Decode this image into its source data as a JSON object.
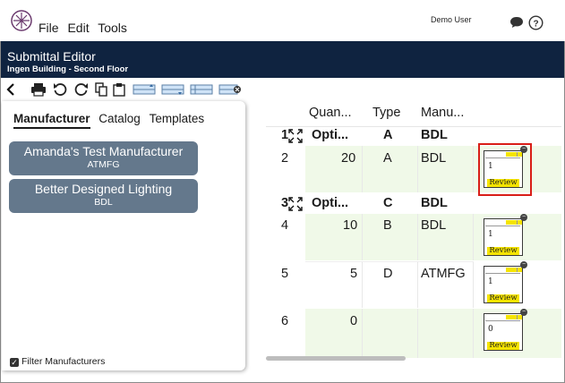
{
  "menu": {
    "file": "File",
    "edit": "Edit",
    "tools": "Tools"
  },
  "user": "Demo User",
  "header": {
    "title": "Submittal Editor",
    "subtitle": "Ingen Building - Second Floor"
  },
  "panel": {
    "tabs": [
      {
        "label": "Manufacturer",
        "active": true
      },
      {
        "label": "Catalog",
        "active": false
      },
      {
        "label": "Templates",
        "active": false
      }
    ],
    "manufacturers": [
      {
        "name": "Amanda's Test Manufacturer",
        "code": "ATMFG"
      },
      {
        "name": "Better Designed Lighting",
        "code": "BDL"
      }
    ],
    "filter_label": "Filter Manufacturers",
    "filter_checked": true
  },
  "grid": {
    "columns": {
      "quantity": "Quan...",
      "type": "Type",
      "manufacturer": "Manu..."
    },
    "rows": [
      {
        "num": "1",
        "group": true,
        "option": "Opti...",
        "type": "A",
        "mfr": "BDL"
      },
      {
        "num": "2",
        "qty": "20",
        "type": "A",
        "mfr": "BDL",
        "thumb_num": "1",
        "thumb_label": "Review"
      },
      {
        "num": "3",
        "group": true,
        "option": "Opti...",
        "type": "C",
        "mfr": "BDL"
      },
      {
        "num": "4",
        "qty": "10",
        "type": "B",
        "mfr": "BDL",
        "thumb_num": "1",
        "thumb_label": "Review"
      },
      {
        "num": "5",
        "qty": "5",
        "type": "D",
        "mfr": "ATMFG",
        "thumb_num": "1",
        "thumb_label": "Review"
      },
      {
        "num": "6",
        "qty": "0",
        "type": "",
        "mfr": "",
        "thumb_num": "0",
        "thumb_label": "Review"
      }
    ]
  },
  "colors": {
    "titlebar": "#0f2340",
    "manufacturer_button": "#64788c",
    "highlight": "#d91e18",
    "row_green": "#f0f9e8",
    "review_yellow": "#f5e400"
  }
}
